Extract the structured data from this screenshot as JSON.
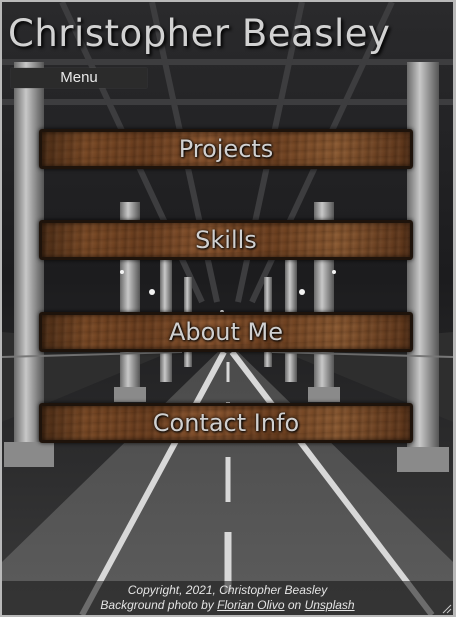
{
  "header": {
    "title": "Christopher Beasley",
    "menu_label": "Menu"
  },
  "nav": {
    "items": [
      {
        "label": "Projects"
      },
      {
        "label": "Skills"
      },
      {
        "label": "About Me"
      },
      {
        "label": "Contact Info"
      }
    ]
  },
  "footer": {
    "copyright": "Copyright, 2021, Christopher Beasley",
    "photo_prefix": "Background photo by",
    "photographer": "Florian Olivo",
    "on_word": "on",
    "site": "Unsplash"
  },
  "icons": {
    "resize": "resize-grip-icon"
  },
  "colors": {
    "title_text": "#d2d2d2",
    "button_wood": "#7a4a26",
    "button_border": "#1e130b",
    "menu_bar": "#2b2b2b"
  }
}
